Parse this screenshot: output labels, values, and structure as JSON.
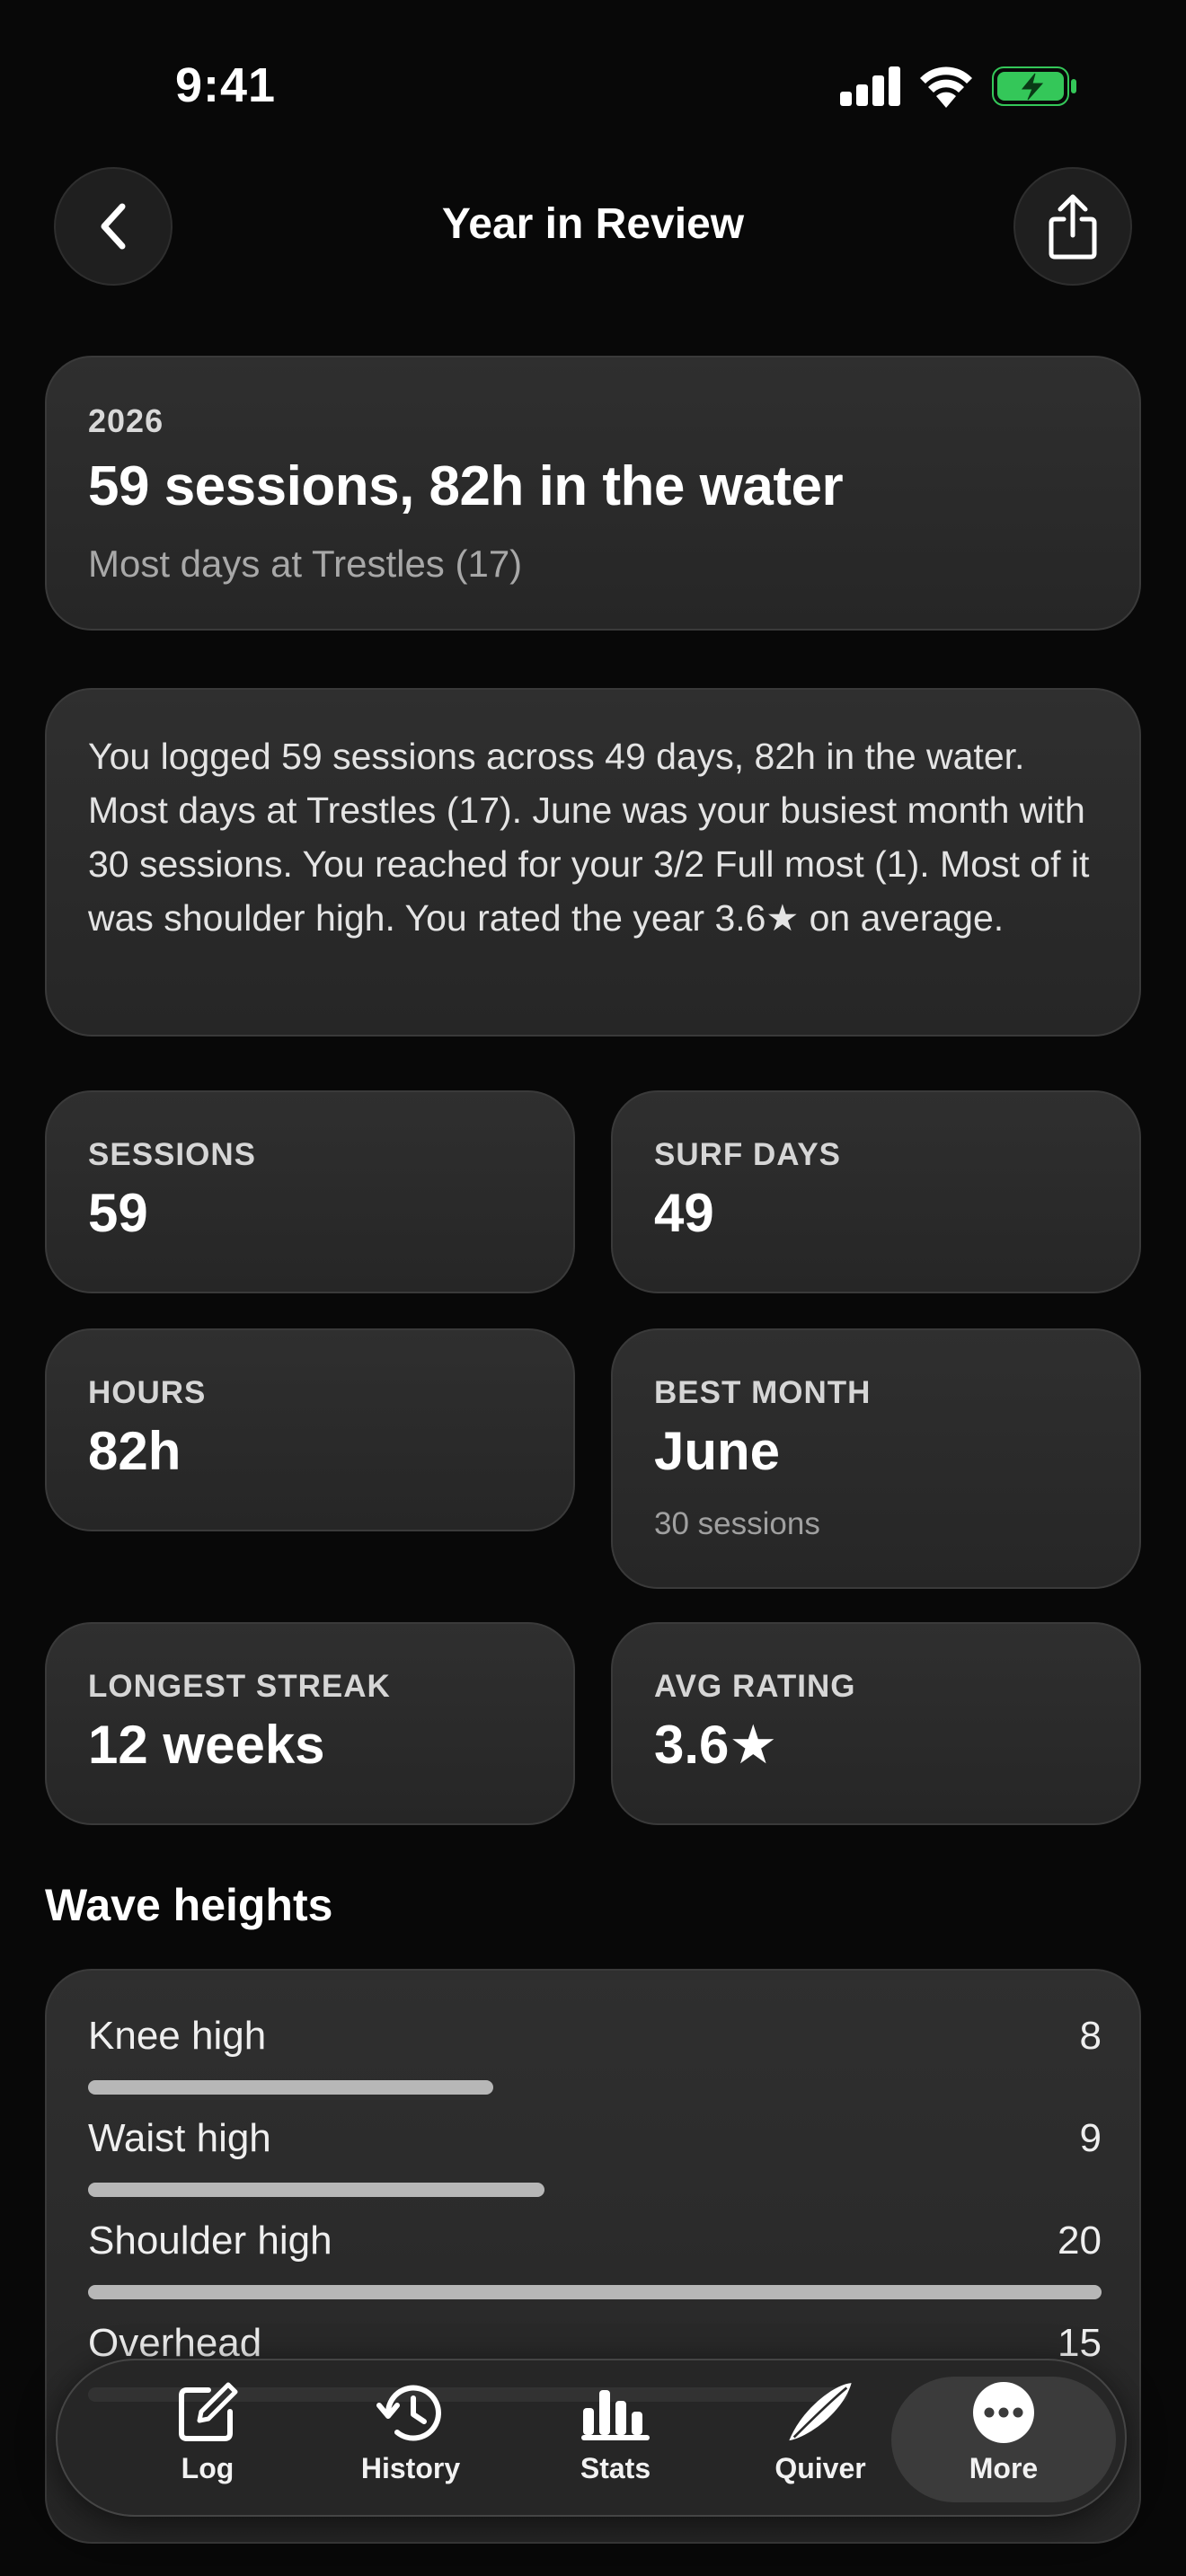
{
  "status": {
    "time": "9:41"
  },
  "header": {
    "title": "Year in Review"
  },
  "hero": {
    "year": "2026",
    "headline": "59 sessions, 82h in the water",
    "subtitle": "Most days at Trestles (17)"
  },
  "summary": {
    "text": "You logged 59 sessions across 49 days, 82h in the water. Most days at Trestles (17). June was your busiest month with 30 sessions. You reached for your 3/2 Full most (1). Most of it was shoulder high. You rated the year 3.6★ on average."
  },
  "stats": {
    "sessions": {
      "label": "SESSIONS",
      "value": "59"
    },
    "surf_days": {
      "label": "SURF DAYS",
      "value": "49"
    },
    "hours": {
      "label": "HOURS",
      "value": "82h"
    },
    "best_month": {
      "label": "BEST MONTH",
      "value": "June",
      "note": "30 sessions"
    },
    "longest_streak": {
      "label": "LONGEST STREAK",
      "value": "12 weeks"
    },
    "avg_rating": {
      "label": "AVG RATING",
      "value": "3.6★"
    }
  },
  "wave_heights": {
    "title": "Wave heights",
    "max": 20,
    "items": [
      {
        "label": "Knee high",
        "count": "8",
        "value": 8
      },
      {
        "label": "Waist high",
        "count": "9",
        "value": 9
      },
      {
        "label": "Shoulder high",
        "count": "20",
        "value": 20
      },
      {
        "label": "Overhead",
        "count": "15",
        "value": 15
      }
    ]
  },
  "tabbar": {
    "log": "Log",
    "history": "History",
    "stats": "Stats",
    "quiver": "Quiver",
    "more": "More",
    "active": "more"
  },
  "colors": {
    "background": "#080808",
    "card": "#2b2b2b",
    "bar_fill": "#b7b7b7",
    "battery_green": "#34c759"
  }
}
